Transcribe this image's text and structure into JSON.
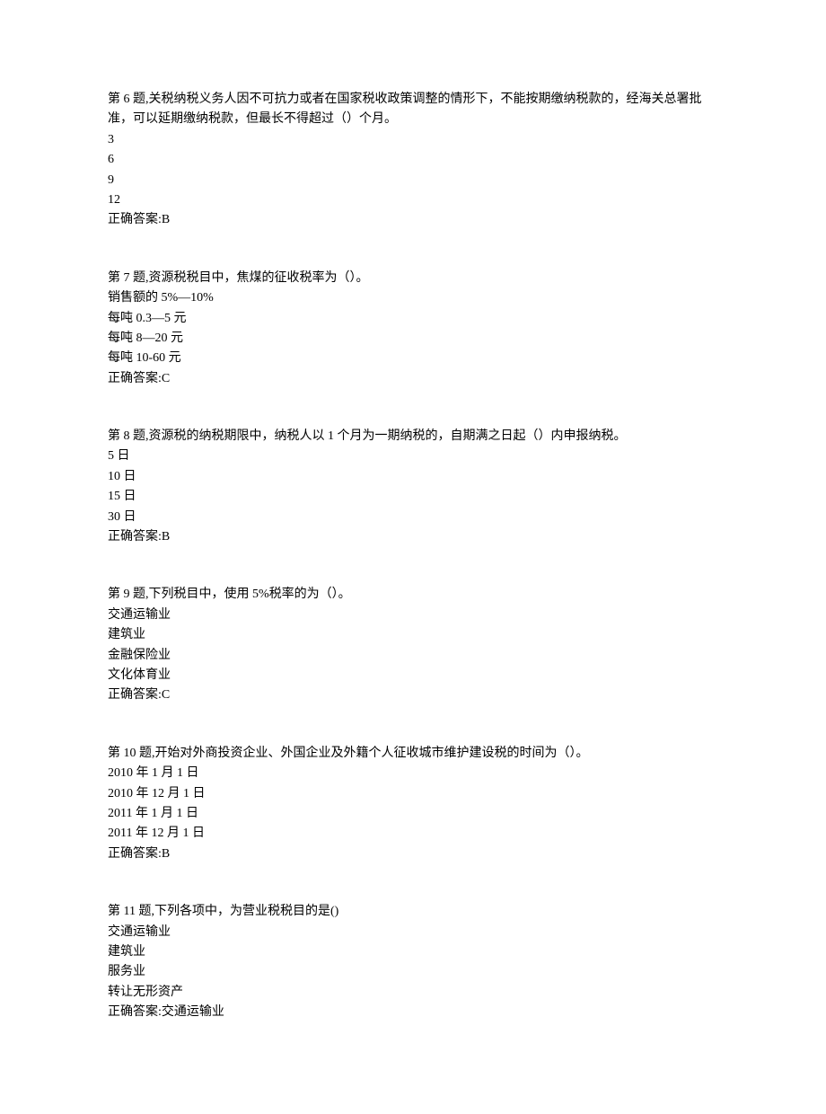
{
  "questions": [
    {
      "stem": "第 6 题,关税纳税义务人因不可抗力或者在国家税收政策调整的情形下，不能按期缴纳税款的，经海关总署批准，可以延期缴纳税款，但最长不得超过（）个月。",
      "options": [
        "3",
        "6",
        "9",
        "12"
      ],
      "answer": "正确答案:B"
    },
    {
      "stem": "第 7 题,资源税税目中，焦煤的征收税率为（）。",
      "options": [
        "销售额的 5%—10%",
        "每吨 0.3—5 元",
        "每吨 8—20 元",
        "每吨 10-60 元"
      ],
      "answer": "正确答案:C"
    },
    {
      "stem": "第 8 题,资源税的纳税期限中，纳税人以 1 个月为一期纳税的，自期满之日起（）内申报纳税。",
      "options": [
        "5 日",
        "10 日",
        "15 日",
        "30 日"
      ],
      "answer": "正确答案:B"
    },
    {
      "stem": "第 9 题,下列税目中，使用 5%税率的为（）。",
      "options": [
        "交通运输业",
        "建筑业",
        "金融保险业",
        "文化体育业"
      ],
      "answer": "正确答案:C"
    },
    {
      "stem": "第 10 题,开始对外商投资企业、外国企业及外籍个人征收城市维护建设税的时间为（）。",
      "options": [
        "2010 年 1 月 1 日",
        "2010 年 12 月 1 日",
        "2011 年 1 月 1 日",
        "2011 年 12 月 1 日"
      ],
      "answer": "正确答案:B"
    },
    {
      "stem": "第 11 题,下列各项中，为营业税税目的是()",
      "options": [
        "交通运输业",
        "建筑业",
        "服务业",
        "转让无形资产"
      ],
      "answer": "正确答案:交通运输业"
    }
  ]
}
